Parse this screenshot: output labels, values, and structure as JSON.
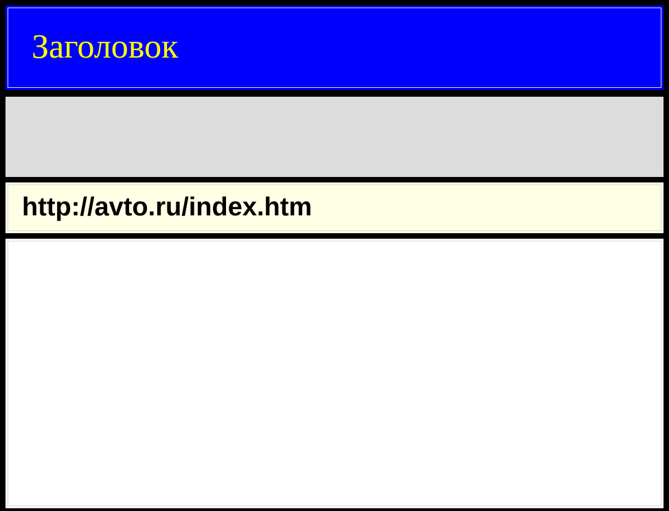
{
  "window": {
    "title": "Заголовок"
  },
  "address_bar": {
    "url": "http://avto.ru/index.htm"
  },
  "colors": {
    "title_bar_bg": "#0000ff",
    "title_text": "#ffff00",
    "toolbar_bg": "#dcdcdc",
    "address_bar_bg": "#ffffe6",
    "content_bg": "#ffffff",
    "frame": "#000000"
  }
}
